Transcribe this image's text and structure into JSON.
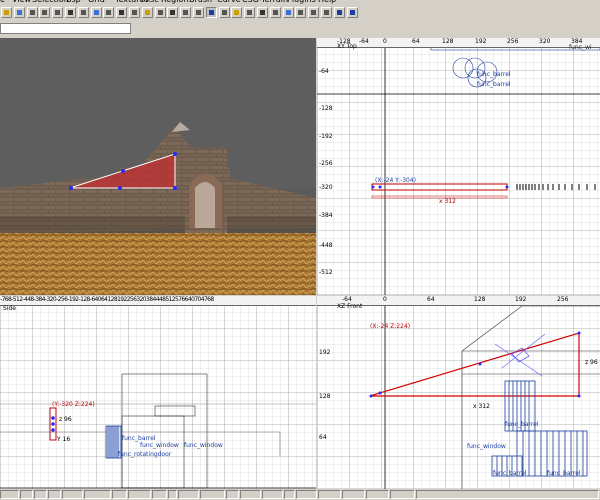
{
  "menu": [
    "e",
    "View",
    "Selection",
    "Bsp",
    "Grid",
    "Textures",
    "Misc",
    "Region",
    "Brush",
    "Curve",
    "CSG-Terrain",
    "Plugins",
    "Help"
  ],
  "toolbar": {
    "buttons": [
      {
        "icon": "open-icon"
      },
      {
        "icon": "save-icon"
      },
      {
        "icon": "flip-x-icon"
      },
      {
        "icon": "flip-y-icon"
      },
      {
        "icon": "rotate-icon"
      },
      {
        "icon": "grid-icon"
      },
      {
        "icon": "camera-icon"
      },
      {
        "icon": "textures-icon"
      },
      {
        "icon": "select-icon"
      },
      {
        "icon": "clip-icon"
      },
      {
        "icon": "brush-icon"
      },
      {
        "icon": "csg-icon"
      },
      {
        "icon": "entity-icon"
      },
      {
        "icon": "view-icon"
      },
      {
        "icon": "patch-icon"
      },
      {
        "icon": "filter-icon"
      },
      {
        "icon": "cursor-icon",
        "active": true
      },
      {
        "icon": "filter-icon"
      },
      {
        "icon": "light-icon"
      },
      {
        "icon": "drag-icon"
      },
      {
        "icon": "scale-icon"
      },
      {
        "icon": "terrain-icon"
      },
      {
        "icon": "plane-icon"
      },
      {
        "icon": "camera-icon"
      },
      {
        "icon": "snap-icon"
      },
      {
        "icon": "cube-icon"
      },
      {
        "icon": "arrow-up-icon"
      },
      {
        "icon": "circle-icon"
      }
    ]
  },
  "command_input": {
    "value": ""
  },
  "views": {
    "camera": {
      "name": ""
    },
    "xy": {
      "name": "XY Top",
      "top_ticks": [
        "-128",
        "-64",
        "0",
        "64",
        "128",
        "192",
        "256",
        "320",
        "384"
      ],
      "left_ticks": [
        "-64",
        "-128",
        "-192",
        "-256",
        "-320",
        "-384",
        "-448",
        "-512"
      ],
      "labels": [
        "func_barrel",
        "func_barrel"
      ],
      "coord_label": "(X:-24 Y:-304)",
      "dim_label": "x 312",
      "top_label": "func_wi"
    },
    "side": {
      "name": "Side",
      "top_ticks": [
        "-768",
        "-512",
        "-448",
        "-384",
        "-320",
        "-256",
        "-192",
        "-128",
        "-64",
        "0",
        "64",
        "128",
        "192",
        "256",
        "320",
        "384",
        "448",
        "512",
        "576",
        "640",
        "704",
        "768",
        "832"
      ],
      "labels": [
        "func_barrel",
        "func_window",
        "func_window",
        "func_rotatingdoor"
      ],
      "coord_label": "(Y:-320 Z:224)",
      "dim_z": "z 96",
      "dim_y": "Y 16"
    },
    "xz": {
      "name": "XZ Front",
      "top_ticks": [
        "-64",
        "0",
        "64",
        "128",
        "192",
        "256"
      ],
      "left_ticks": [
        "192",
        "128",
        "64"
      ],
      "labels": [
        "func_barrel",
        "func_window",
        "func_barrel",
        "func_barrel"
      ],
      "coord_label": "(X:-24 Z:224)",
      "dim_x": "x 312",
      "dim_z": "z 96"
    }
  },
  "statusbar": {
    "cells": [
      "",
      "",
      "",
      "",
      "",
      "",
      "",
      "",
      "",
      "",
      "",
      "",
      "",
      "",
      "",
      "",
      "",
      "",
      "",
      "",
      "",
      ""
    ]
  }
}
